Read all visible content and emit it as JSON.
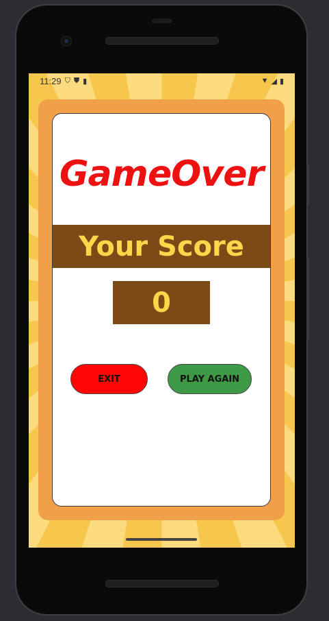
{
  "status_bar": {
    "time": "11:29",
    "icons_left": [
      "shield-outline-icon",
      "shield-filled-icon",
      "sim-card-icon"
    ],
    "icons_right": [
      "wifi-icon",
      "signal-icon",
      "battery-icon"
    ]
  },
  "game_over": {
    "title": "GameOver",
    "score_label": "Your Score",
    "score_value": "0",
    "exit_label": "EXIT",
    "play_again_label": "PLAY AGAIN"
  },
  "colors": {
    "title": "#ee1111",
    "score_band": "#7b4a17",
    "score_text": "#ffd54a",
    "exit_button": "#ff0505",
    "play_button": "#3f9a47",
    "card_frame": "#f0a049"
  }
}
